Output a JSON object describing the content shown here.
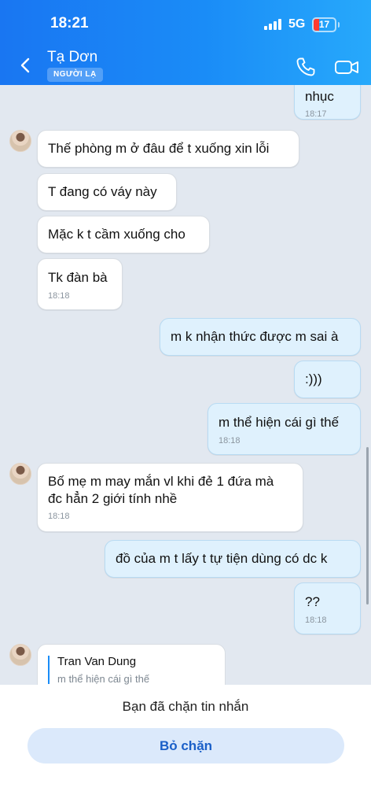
{
  "status_bar": {
    "time": "18:21",
    "network": "5G",
    "battery": "17"
  },
  "header": {
    "title": "Tạ Dơn",
    "badge": "NGƯỜI LẠ"
  },
  "messages": [
    {
      "side": "out",
      "text": "nhục",
      "time": "18:17"
    },
    {
      "side": "in",
      "text": "Thế phòng m ở đâu để t xuống xin lỗi"
    },
    {
      "side": "in",
      "text": "T đang có váy này"
    },
    {
      "side": "in",
      "text": "Mặc k t cầm xuống cho"
    },
    {
      "side": "in",
      "text": "Tk đàn bà",
      "time": "18:18"
    },
    {
      "side": "out",
      "text": "m k nhận thức được m sai à"
    },
    {
      "side": "out",
      "text": ":)))"
    },
    {
      "side": "out",
      "text": "m thể hiện cái gì thế",
      "time": "18:18"
    },
    {
      "side": "in",
      "text_line1": "Bố mẹ m may mắn vl khi đẻ 1 đứa mà",
      "text_line2": "đc hẳn 2 giới tính nhề",
      "time": "18:18"
    },
    {
      "side": "out",
      "text": "đồ của m t lấy t tự tiện dùng có dc k"
    },
    {
      "side": "out",
      "text": "??",
      "time": "18:18"
    }
  ],
  "reply_preview": {
    "name": "Tran Van Dung",
    "quoted": "m thể hiện cái gì thế"
  },
  "footer": {
    "blocked_notice": "Bạn đã chặn tin nhắn",
    "unblock_label": "Bỏ chặn"
  },
  "colors": {
    "header_start": "#1976f2",
    "header_end": "#27a9fb",
    "outgoing_bubble": "#dff1fd",
    "incoming_bubble": "#ffffff",
    "chat_background": "#e2e8f0",
    "accent": "#1a5fc8"
  }
}
